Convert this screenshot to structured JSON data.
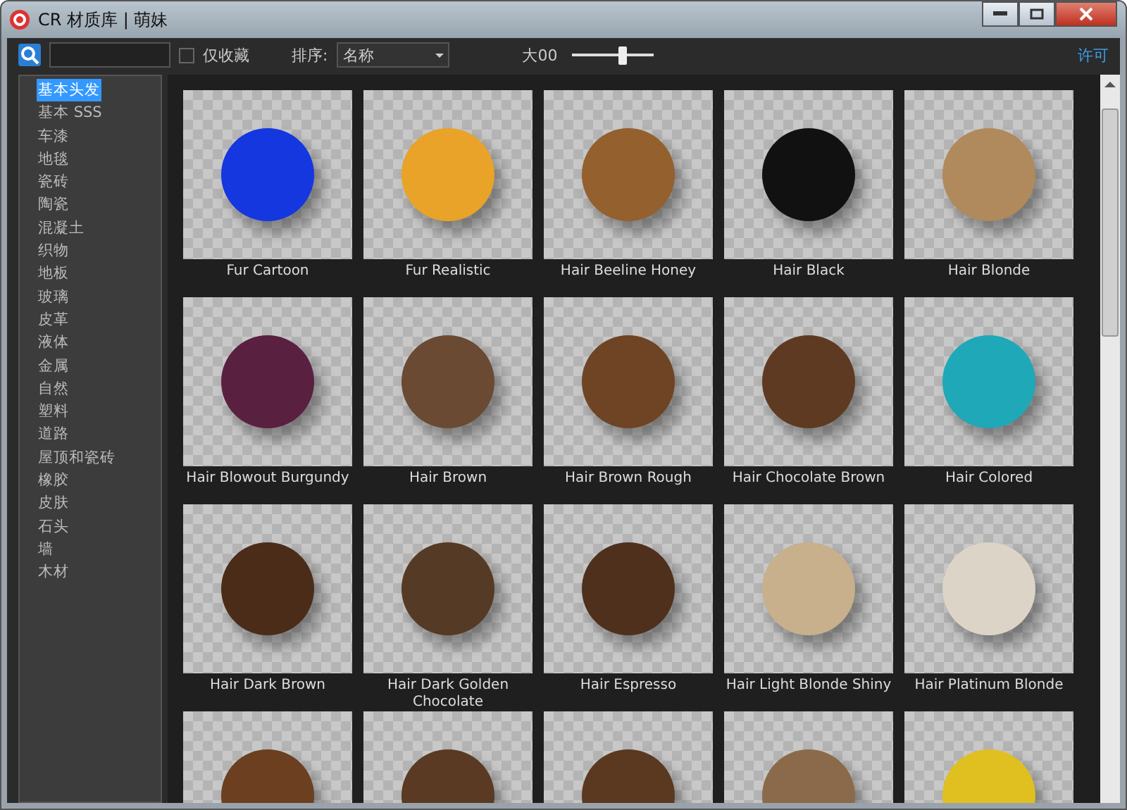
{
  "window": {
    "title": "CR 材质库 | 萌妹"
  },
  "toolbar": {
    "favorites_only": {
      "label": "仅收藏",
      "checked": false
    },
    "sort": {
      "label": "排序:",
      "value": "名称"
    },
    "size": {
      "label": "大00",
      "level": 0.62
    },
    "license_link": "许可"
  },
  "sidebar": {
    "items": [
      {
        "label": "基本头发",
        "selected": true
      },
      {
        "label": "基本 SSS",
        "selected": false
      },
      {
        "label": "车漆",
        "selected": false
      },
      {
        "label": "地毯",
        "selected": false
      },
      {
        "label": "瓷砖",
        "selected": false
      },
      {
        "label": "陶瓷",
        "selected": false
      },
      {
        "label": "混凝土",
        "selected": false
      },
      {
        "label": "织物",
        "selected": false
      },
      {
        "label": "地板",
        "selected": false
      },
      {
        "label": "玻璃",
        "selected": false
      },
      {
        "label": "皮革",
        "selected": false
      },
      {
        "label": "液体",
        "selected": false
      },
      {
        "label": "金属",
        "selected": false
      },
      {
        "label": "自然",
        "selected": false
      },
      {
        "label": "塑料",
        "selected": false
      },
      {
        "label": "道路",
        "selected": false
      },
      {
        "label": "屋顶和瓷砖",
        "selected": false
      },
      {
        "label": "橡胶",
        "selected": false
      },
      {
        "label": "皮肤",
        "selected": false
      },
      {
        "label": "石头",
        "selected": false
      },
      {
        "label": "墙",
        "selected": false
      },
      {
        "label": "木材",
        "selected": false
      }
    ]
  },
  "materials": [
    {
      "name": "Fur Cartoon",
      "color": "#1437e0"
    },
    {
      "name": "Fur Realistic",
      "color": "#e8a328"
    },
    {
      "name": "Hair Beeline Honey",
      "color": "#93602e"
    },
    {
      "name": "Hair Black",
      "color": "#111111"
    },
    {
      "name": "Hair Blonde",
      "color": "#b08a5c"
    },
    {
      "name": "Hair Blowout Burgundy",
      "color": "#5a2040"
    },
    {
      "name": "Hair Brown",
      "color": "#6a4a32"
    },
    {
      "name": "Hair Brown Rough",
      "color": "#6e4424"
    },
    {
      "name": "Hair Chocolate Brown",
      "color": "#5e3a22"
    },
    {
      "name": "Hair Colored",
      "color": "#1fa8b8"
    },
    {
      "name": "Hair Dark Brown",
      "color": "#4a2c18"
    },
    {
      "name": "Hair Dark Golden Chocolate",
      "color": "#553a26"
    },
    {
      "name": "Hair Espresso",
      "color": "#4e301c"
    },
    {
      "name": "Hair Light Blonde Shiny",
      "color": "#c8b08c"
    },
    {
      "name": "Hair Platinum Blonde",
      "color": "#ddd4c8"
    },
    {
      "color": "#6b3f1f"
    },
    {
      "color": "#5a3a22"
    },
    {
      "color": "#5b3820"
    },
    {
      "color": "#8a6a4a"
    },
    {
      "color": "#e0c020"
    }
  ]
}
